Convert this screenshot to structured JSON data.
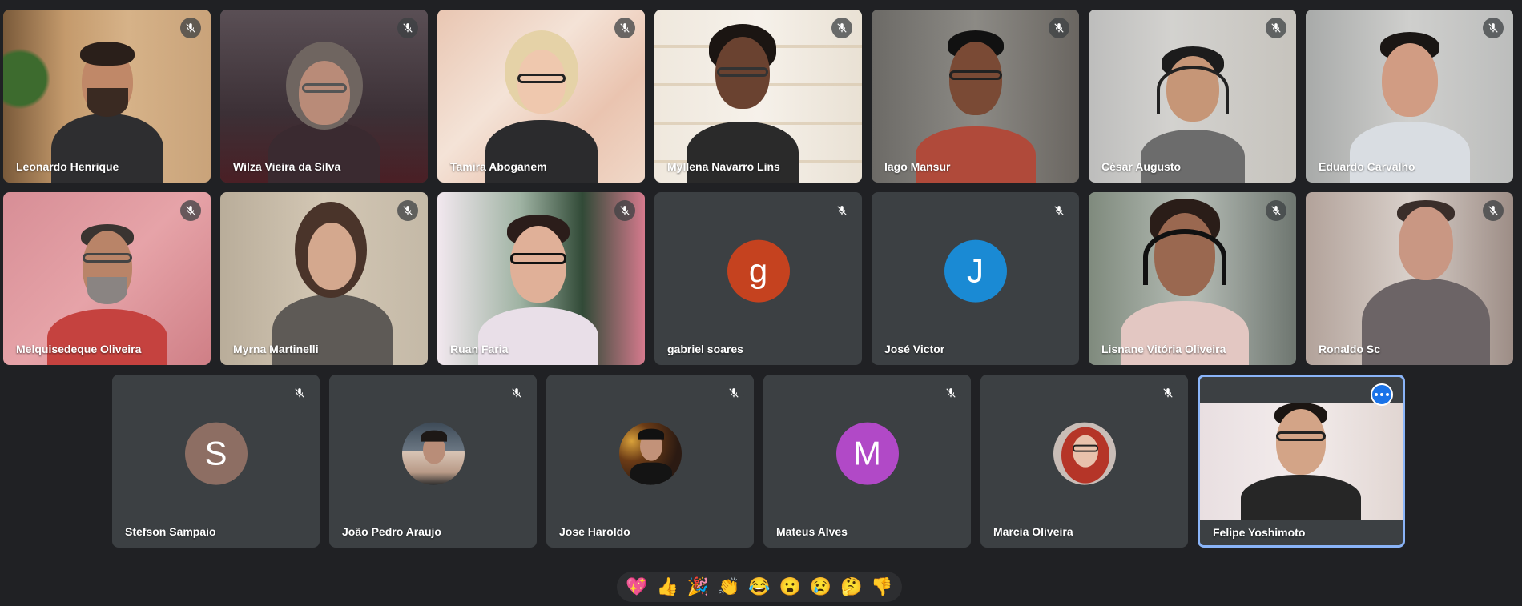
{
  "participants_row1": [
    {
      "name": "Leonardo Henrique"
    },
    {
      "name": "Wilza Vieira da Silva"
    },
    {
      "name": "Tamira Aboganem"
    },
    {
      "name": "Myllena Navarro Lins"
    },
    {
      "name": "Iago Mansur"
    },
    {
      "name": "César Augusto"
    },
    {
      "name": "Eduardo Carvalho"
    }
  ],
  "participants_row2": [
    {
      "name": "Melquisedeque Oliveira"
    },
    {
      "name": "Myrna Martinelli"
    },
    {
      "name": "Ruan Faria"
    },
    {
      "name": "gabriel soares",
      "initial": "g",
      "color": "#c5421f"
    },
    {
      "name": "José Victor",
      "initial": "J",
      "color": "#1a8ad4"
    },
    {
      "name": "Lisnane Vitória Oliveira"
    },
    {
      "name": "Ronaldo Sc"
    }
  ],
  "participants_row3": [
    {
      "name": "Stefson Sampaio",
      "initial": "S",
      "color": "#8d6e63"
    },
    {
      "name": "João Pedro Araujo"
    },
    {
      "name": "Jose Haroldo"
    },
    {
      "name": "Mateus Alves",
      "initial": "M",
      "color": "#b149c7"
    },
    {
      "name": "Marcia Oliveira"
    },
    {
      "name": "Felipe Yoshimoto"
    }
  ],
  "reactions": [
    "💖",
    "👍",
    "🎉",
    "👏",
    "😂",
    "😮",
    "😢",
    "🤔",
    "👎"
  ],
  "icons": {
    "mute": "mic-off-icon",
    "more": "more-options-icon"
  },
  "colors": {
    "background": "#202124",
    "tile": "#3c4043",
    "active_border": "#8ab4f8"
  }
}
